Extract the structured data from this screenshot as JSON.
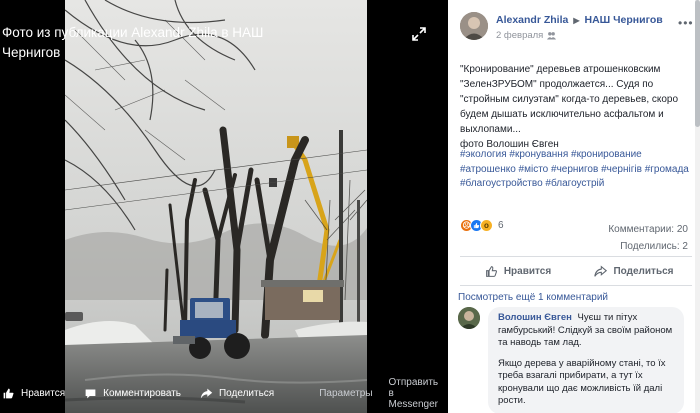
{
  "viewer": {
    "title": "Фото из публикации Alexandr Zhila в НАШ Чернигов",
    "expand_icon": "expand-icon",
    "actions": {
      "like": "Нравится",
      "comment": "Комментировать",
      "share": "Поделиться",
      "options": "Параметры",
      "messenger": "Отправить в Messenger"
    }
  },
  "post": {
    "author": "Alexandr Zhila",
    "group": "НАШ Чернигов",
    "date": "2 февраля",
    "text": "\"Кронирование\" деревьев атрошенковским \"ЗеленЗРУБОМ\" продолжается... Судя по \"стройным силуэтам\" когда-то деревьев, скоро будем дышать исключительно асфальтом и выхлопами...",
    "credit": "фото Волошин Євген",
    "hashtags": "#экология #кронування #кронирование #атрошенко #місто #чернигов #чернігів #громада #благоустройство #благоустрій",
    "reactions_count": "6",
    "comments_count": "Комментарии: 20",
    "shares_count": "Поделились: 2",
    "like_label": "Нравится",
    "share_label": "Поделиться"
  },
  "comments": {
    "more": "Посмотреть ещё 1 комментарий",
    "items": [
      {
        "author": "Волошин Євген",
        "text1": "Чуєш ти пітух гамбурський! Слідкуй за своїм районом та наводь там лад.",
        "text2": "Якщо дерева у аварійному стані, то їх треба взагалі прибирати, а тут їх кронували що дає можливість їй далі рости."
      }
    ]
  },
  "colors": {
    "link": "#385898",
    "secondary_text": "#606770",
    "angry": "#e9710f",
    "like": "#1877f2",
    "wow": "#f7b125"
  }
}
